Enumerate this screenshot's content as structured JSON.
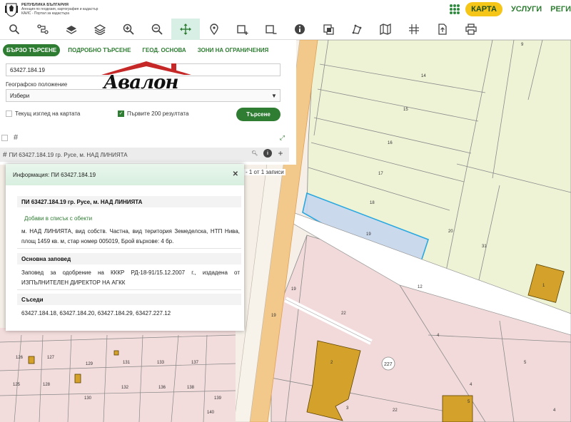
{
  "header": {
    "logo_line1": "РЕПУБЛИКА БЪЛГАРИЯ",
    "logo_line2": "Агенция по геодезия, картография и кадастър",
    "logo_line3": "КАИС - Портал за кадастъра",
    "nav": {
      "map": "КАРТА",
      "services": "УСЛУГИ",
      "regs": "РЕГИ"
    }
  },
  "toolbar": {
    "tools": [
      "search-icon",
      "route-icon",
      "layers-icon",
      "layer-stack-icon",
      "zoom-in-icon",
      "zoom-out-icon",
      "pan-icon",
      "location-pin-icon",
      "add-area-icon",
      "remove-area-icon",
      "info-icon",
      "select-area-icon",
      "measure-icon",
      "map-icon",
      "crosshair-icon",
      "export-icon",
      "print-icon"
    ],
    "active_tool": "pan-icon"
  },
  "search": {
    "tabs": [
      "БЪРЗО ТЪРСЕНЕ",
      "ПОДРОБНО ТЪРСЕНЕ",
      "ГЕОД. ОСНОВА",
      "ЗОНИ НА ОГРАНИЧЕНИЯ"
    ],
    "query_value": "63427.184.19",
    "geo_label": "Географско положение",
    "geo_select": "Избери",
    "current_view_label": "Текущ изглед на картата",
    "first200_label": "Първите 200 резултата",
    "search_button": "Търсене",
    "result_item": "ПИ 63427.184.19 гр. Русе, м. НАД ЛИНИЯТА",
    "records": "- 1 от 1 записи"
  },
  "watermark": {
    "text": "Авалон"
  },
  "popup": {
    "title": "Информация: ПИ 63427.184.19",
    "heading": "ПИ 63427.184.19 гр. Русе, м. НАД ЛИНИЯТА",
    "add_link": "Добави в списък с обекти",
    "description": "м. НАД ЛИНИЯТА, вид собств. Частна, вид територия Земеделска, НТП Нива, площ 1459 кв. м, стар номер 005019, Брой върхове: 4 бр.",
    "order_title": "Основна заповед",
    "order_text": "Заповед за одобрение на КККР РД-18-91/15.12.2007 г., издадена от ИЗПЪЛНИТЕЛЕН ДИРЕКТОР НА АГКК",
    "neighbors_title": "Съседи",
    "neighbors": "63427.184.18, 63427.184.20, 63427.184.29, 63427.227.12"
  },
  "map_labels": {
    "parcels": [
      "9",
      "14",
      "15",
      "16",
      "17",
      "18",
      "19",
      "20",
      "21",
      "31",
      "12",
      "22",
      "4",
      "5",
      "1",
      "2",
      "3",
      "4",
      "5",
      "22",
      "4",
      "125",
      "126",
      "127",
      "128",
      "129",
      "130",
      "131",
      "132",
      "133",
      "136",
      "137",
      "138",
      "139",
      "140",
      "19",
      "19"
    ],
    "block": "227"
  },
  "colors": {
    "accent": "#2e7d32",
    "highlight": "#f5c518",
    "parcel_green": "#eef3d6",
    "parcel_pink": "#f3d9d9",
    "road": "#f2c98a",
    "selection": "#29a8e0",
    "building": "#d4a22a"
  }
}
